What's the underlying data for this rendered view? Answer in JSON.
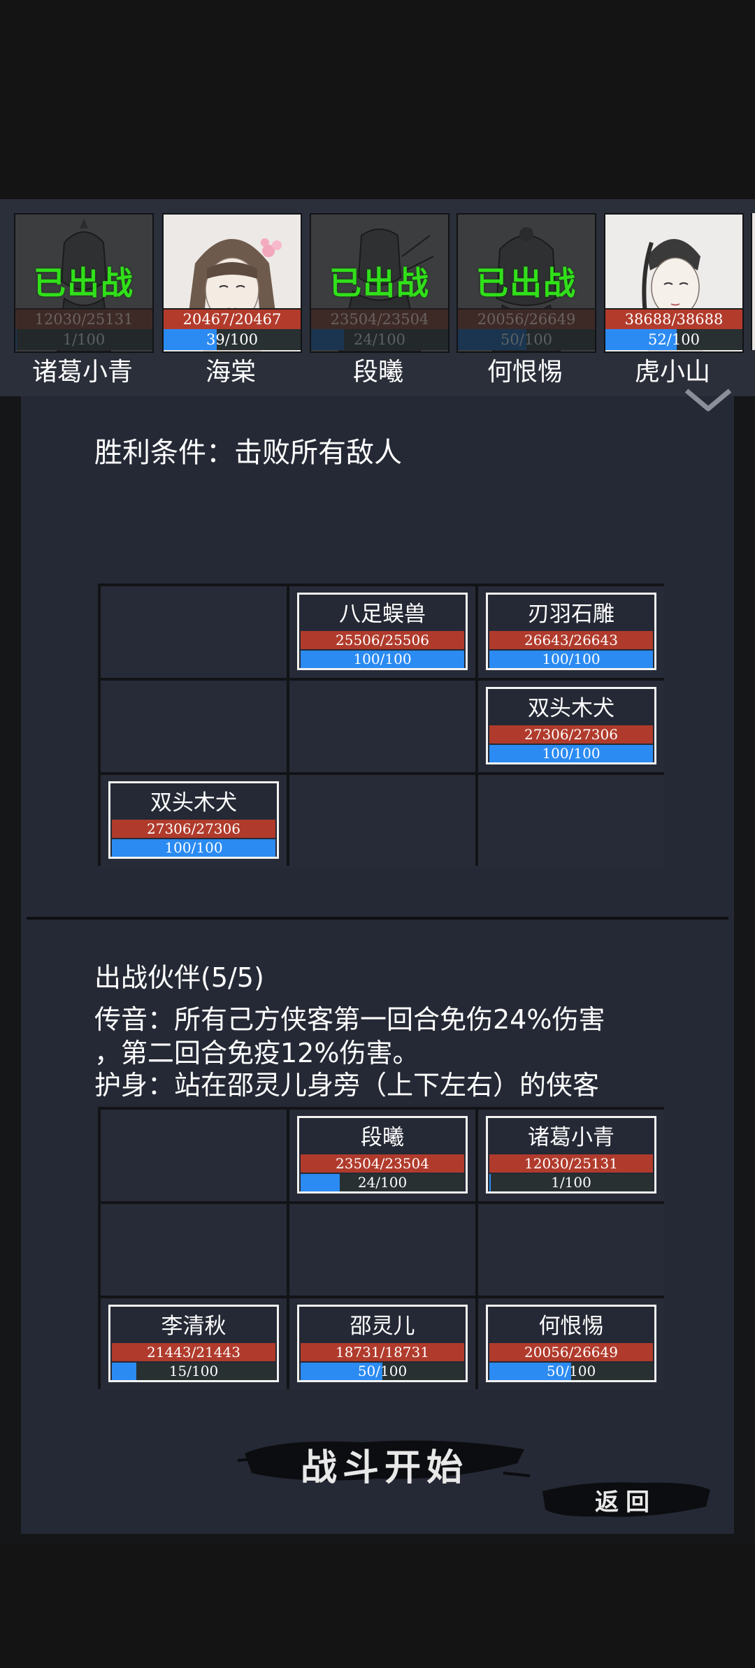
{
  "roster": [
    {
      "name": "诸葛小青",
      "hp": "12030/25131",
      "mp": "1/100",
      "mp_fraction": 0.01,
      "deployed": true,
      "deployed_label": "已出战"
    },
    {
      "name": "海棠",
      "hp": "20467/20467",
      "mp": "39/100",
      "mp_fraction": 0.39,
      "deployed": false
    },
    {
      "name": "段曦",
      "hp": "23504/23504",
      "mp": "24/100",
      "mp_fraction": 0.24,
      "deployed": true,
      "deployed_label": "已出战"
    },
    {
      "name": "何恨惕",
      "hp": "20056/26649",
      "mp": "50/100",
      "mp_fraction": 0.5,
      "deployed": true,
      "deployed_label": "已出战"
    },
    {
      "name": "虎小山",
      "hp": "38688/38688",
      "mp": "52/100",
      "mp_fraction": 0.52,
      "deployed": false
    }
  ],
  "victory_condition": "胜利条件：击败所有敌人",
  "enemy_grid": [
    {
      "row": 0,
      "col": 1,
      "name": "八足蜈兽",
      "hp": "25506/25506",
      "mp": "100/100",
      "mp_fraction": 1.0
    },
    {
      "row": 0,
      "col": 2,
      "name": "刃羽石雕",
      "hp": "26643/26643",
      "mp": "100/100",
      "mp_fraction": 1.0
    },
    {
      "row": 1,
      "col": 2,
      "name": "双头木犬",
      "hp": "27306/27306",
      "mp": "100/100",
      "mp_fraction": 1.0
    },
    {
      "row": 2,
      "col": 0,
      "name": "双头木犬",
      "hp": "27306/27306",
      "mp": "100/100",
      "mp_fraction": 1.0
    }
  ],
  "partner_title": "出战伙伴(5/5)",
  "skill_lines": [
    "传音：所有己方侠客第一回合免伤24%伤害",
    "，第二回合免疫12%伤害。",
    "护身：站在邵灵儿身旁（上下左右）的侠客"
  ],
  "ally_grid": [
    {
      "row": 0,
      "col": 1,
      "name": "段曦",
      "hp": "23504/23504",
      "mp": "24/100",
      "mp_fraction": 0.24
    },
    {
      "row": 0,
      "col": 2,
      "name": "诸葛小青",
      "hp": "12030/25131",
      "mp": "1/100",
      "mp_fraction": 0.01
    },
    {
      "row": 2,
      "col": 0,
      "name": "李清秋",
      "hp": "21443/21443",
      "mp": "15/100",
      "mp_fraction": 0.15
    },
    {
      "row": 2,
      "col": 1,
      "name": "邵灵儿",
      "hp": "18731/18731",
      "mp": "50/100",
      "mp_fraction": 0.5
    },
    {
      "row": 2,
      "col": 2,
      "name": "何恨惕",
      "hp": "20056/26649",
      "mp": "50/100",
      "mp_fraction": 0.5
    }
  ],
  "buttons": {
    "start": "战斗开始",
    "back": "返回"
  },
  "colors": {
    "hp_red": "#b03b2c",
    "mp_blue": "#2b8bf2",
    "deployed_green": "#31e01a",
    "panel": "#252935"
  }
}
